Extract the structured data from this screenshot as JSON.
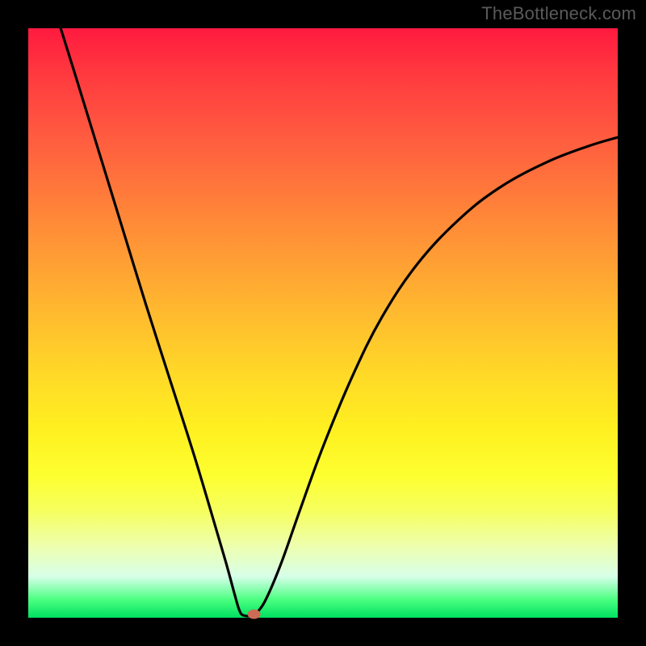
{
  "watermark": "TheBottleneck.com",
  "colors": {
    "frame": "#000000",
    "gradient_top": "#ff1a3f",
    "gradient_bottom": "#00e060",
    "curve": "#000000",
    "marker": "#cc6b55"
  },
  "chart_data": {
    "type": "line",
    "title": "",
    "xlabel": "",
    "ylabel": "",
    "xlim": [
      0,
      100
    ],
    "ylim": [
      0,
      100
    ],
    "grid": false,
    "legend": false,
    "annotations": [],
    "series": [
      {
        "name": "bottleneck-curve",
        "points": [
          {
            "x": 5.5,
            "y": 100.0
          },
          {
            "x": 8.0,
            "y": 92.0
          },
          {
            "x": 12.0,
            "y": 79.0
          },
          {
            "x": 16.0,
            "y": 66.0
          },
          {
            "x": 20.0,
            "y": 53.0
          },
          {
            "x": 24.0,
            "y": 40.5
          },
          {
            "x": 28.0,
            "y": 28.0
          },
          {
            "x": 31.0,
            "y": 18.0
          },
          {
            "x": 33.5,
            "y": 9.5
          },
          {
            "x": 35.0,
            "y": 4.0
          },
          {
            "x": 35.8,
            "y": 1.3
          },
          {
            "x": 36.5,
            "y": 0.4
          },
          {
            "x": 38.0,
            "y": 0.4
          },
          {
            "x": 39.0,
            "y": 1.1
          },
          {
            "x": 40.5,
            "y": 3.5
          },
          {
            "x": 43.0,
            "y": 9.5
          },
          {
            "x": 46.0,
            "y": 18.0
          },
          {
            "x": 50.0,
            "y": 29.0
          },
          {
            "x": 55.0,
            "y": 41.0
          },
          {
            "x": 60.0,
            "y": 51.0
          },
          {
            "x": 66.0,
            "y": 60.0
          },
          {
            "x": 73.0,
            "y": 67.5
          },
          {
            "x": 80.0,
            "y": 73.0
          },
          {
            "x": 88.0,
            "y": 77.3
          },
          {
            "x": 95.0,
            "y": 80.0
          },
          {
            "x": 100.0,
            "y": 81.5
          }
        ]
      }
    ],
    "marker": {
      "x": 38.3,
      "y": 0.6,
      "rx": 1.1,
      "ry": 0.8
    }
  }
}
